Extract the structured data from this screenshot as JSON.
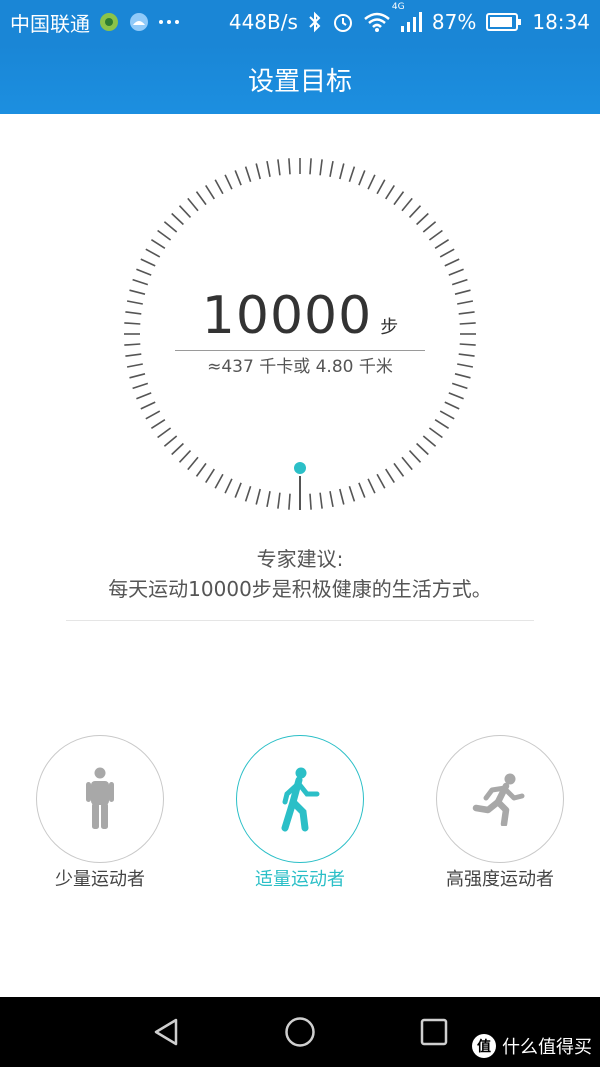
{
  "status_bar": {
    "carrier": "中国联通",
    "network_speed": "448B/s",
    "network_type": "4G",
    "battery": "87%",
    "time": "18:34",
    "icons": [
      "app-notification-icon",
      "weather-icon",
      "more-icon",
      "bluetooth-icon",
      "alarm-icon",
      "wifi-icon",
      "signal-icon",
      "battery-icon"
    ]
  },
  "header": {
    "title": "设置目标"
  },
  "dial": {
    "steps": "10000",
    "unit": "步",
    "conversion": "≈437 千卡或 4.80 千米",
    "accent": "#2bbfc7"
  },
  "advice": {
    "line1": "专家建议:",
    "line2": "每天运动10000步是积极健康的生活方式。"
  },
  "modes": [
    {
      "label": "少量运动者",
      "icon": "standing-person-icon",
      "selected": false
    },
    {
      "label": "适量运动者",
      "icon": "walking-person-icon",
      "selected": true
    },
    {
      "label": "高强度运动者",
      "icon": "running-person-icon",
      "selected": false
    }
  ],
  "nav": {
    "icons": [
      "back-icon",
      "home-icon",
      "recents-icon"
    ]
  },
  "watermark": {
    "badge": "值",
    "text": "什么值得买"
  }
}
